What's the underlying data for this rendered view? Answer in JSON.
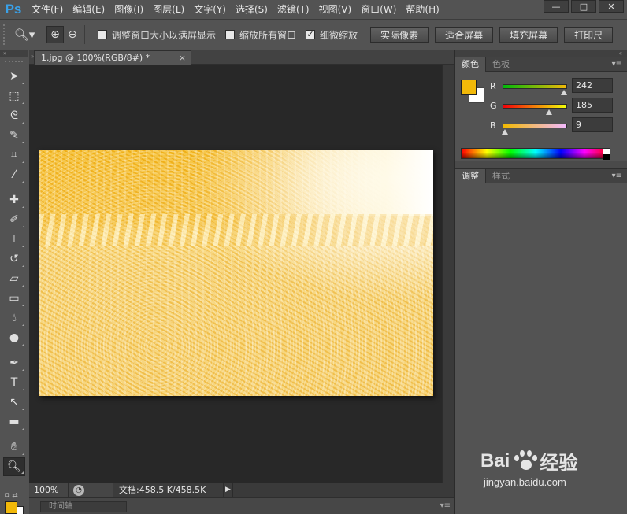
{
  "app": {
    "logo": "Ps"
  },
  "menu": [
    "文件(F)",
    "编辑(E)",
    "图像(I)",
    "图层(L)",
    "文字(Y)",
    "选择(S)",
    "滤镜(T)",
    "视图(V)",
    "窗口(W)",
    "帮助(H)"
  ],
  "window_controls": {
    "minimize": "—",
    "maximize": "□",
    "close": "✕"
  },
  "options": {
    "resize_window": {
      "label": "调整窗口大小以满屏显示",
      "checked": false
    },
    "zoom_all_windows": {
      "label": "缩放所有窗口",
      "checked": false
    },
    "scrubby_zoom": {
      "label": "细微缩放",
      "checked": true
    },
    "actual_pixels": "实际像素",
    "fit_screen": "适合屏幕",
    "fill_screen": "填充屏幕",
    "print_size": "打印尺"
  },
  "document": {
    "tab_title": "1.jpg @ 100%(RGB/8#) *",
    "tab_close": "×"
  },
  "status": {
    "zoom": "100%",
    "doc_info": "文档:458.5 K/458.5K",
    "arrow": "▶"
  },
  "timeline": {
    "label": "时间轴"
  },
  "color_panel": {
    "tabs": [
      "颜色",
      "色板"
    ],
    "foreground": "#f2b909",
    "background": "#ffffff",
    "channels": [
      {
        "name": "R",
        "value": "242",
        "fraction": 0.949
      },
      {
        "name": "G",
        "value": "185",
        "fraction": 0.725
      },
      {
        "name": "B",
        "value": "9",
        "fraction": 0.035
      }
    ]
  },
  "adjust_panel": {
    "tabs": [
      "调整",
      "样式"
    ]
  },
  "watermark": {
    "brand_left": "Bai",
    "brand_right": "经验",
    "url": "jingyan.baidu.com"
  },
  "colors": {
    "accent": "#f2b909",
    "ps_blue": "#3aa1e8",
    "panel_bg": "#535353",
    "canvas_bg": "#282828"
  }
}
